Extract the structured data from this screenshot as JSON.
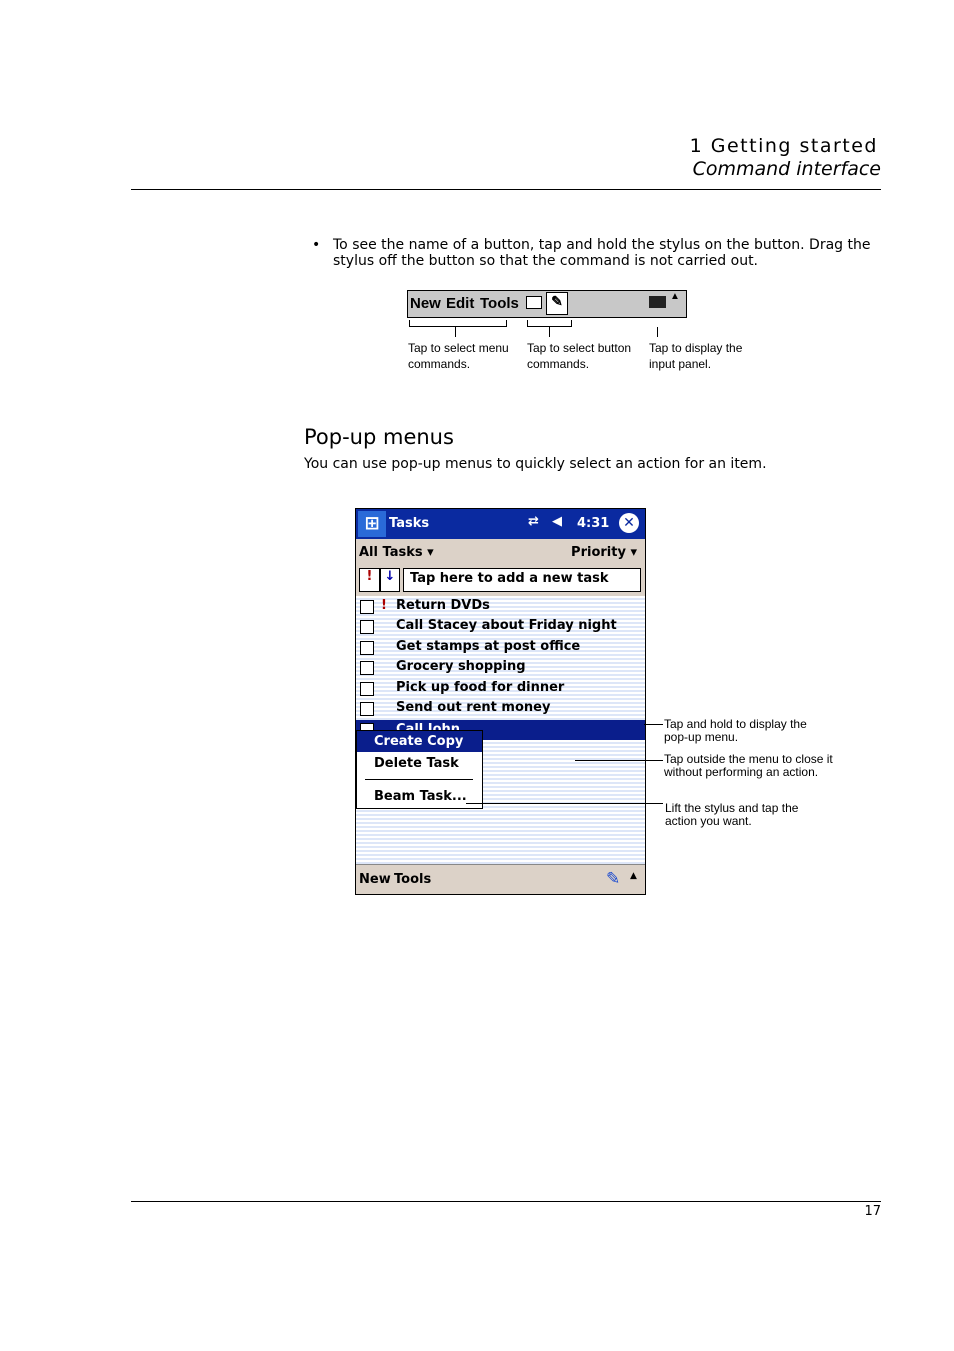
{
  "header": {
    "chapter": "1 Getting started",
    "section": "Command interface"
  },
  "bullet": "To see the name of a button, tap and hold the stylus on the button. Drag the stylus off the button so that the command is not carried out.",
  "command_bar": {
    "menus": [
      "New",
      "Edit",
      "Tools"
    ],
    "icons": [
      "keyboard-input-icon",
      "pen-icon",
      "keyboard-icon",
      "up-arrow-icon"
    ],
    "captions": [
      "Tap to select menu commands.",
      "Tap to select button commands.",
      "Tap to display the input panel."
    ]
  },
  "popup": {
    "heading": "Pop-up menus",
    "intro": "You can use pop-up menus to quickly select an action for an item."
  },
  "device": {
    "title": "Tasks",
    "time": "4:31",
    "filter": "All Tasks",
    "sort": "Priority",
    "new_task_placeholder": "Tap here to add a new task",
    "tasks": [
      {
        "label": "Return DVDs",
        "high_priority": true
      },
      {
        "label": "Call Stacey about Friday night"
      },
      {
        "label": "Get stamps at post office"
      },
      {
        "label": "Grocery shopping"
      },
      {
        "label": "Pick up food for dinner"
      },
      {
        "label": "Send out rent money"
      },
      {
        "label": "Call John",
        "selected": true
      }
    ],
    "menu": [
      "Create Copy",
      "Delete Task",
      "Beam Task..."
    ],
    "bottom_menus": [
      "New",
      "Tools"
    ],
    "selection_color": "#0a1e8c"
  },
  "annotations": [
    "Tap and hold to display the pop-up menu.",
    "Tap outside the menu to close it without performing an action.",
    "Lift the stylus and tap the action you want."
  ],
  "footer": {
    "page_number": "17"
  }
}
